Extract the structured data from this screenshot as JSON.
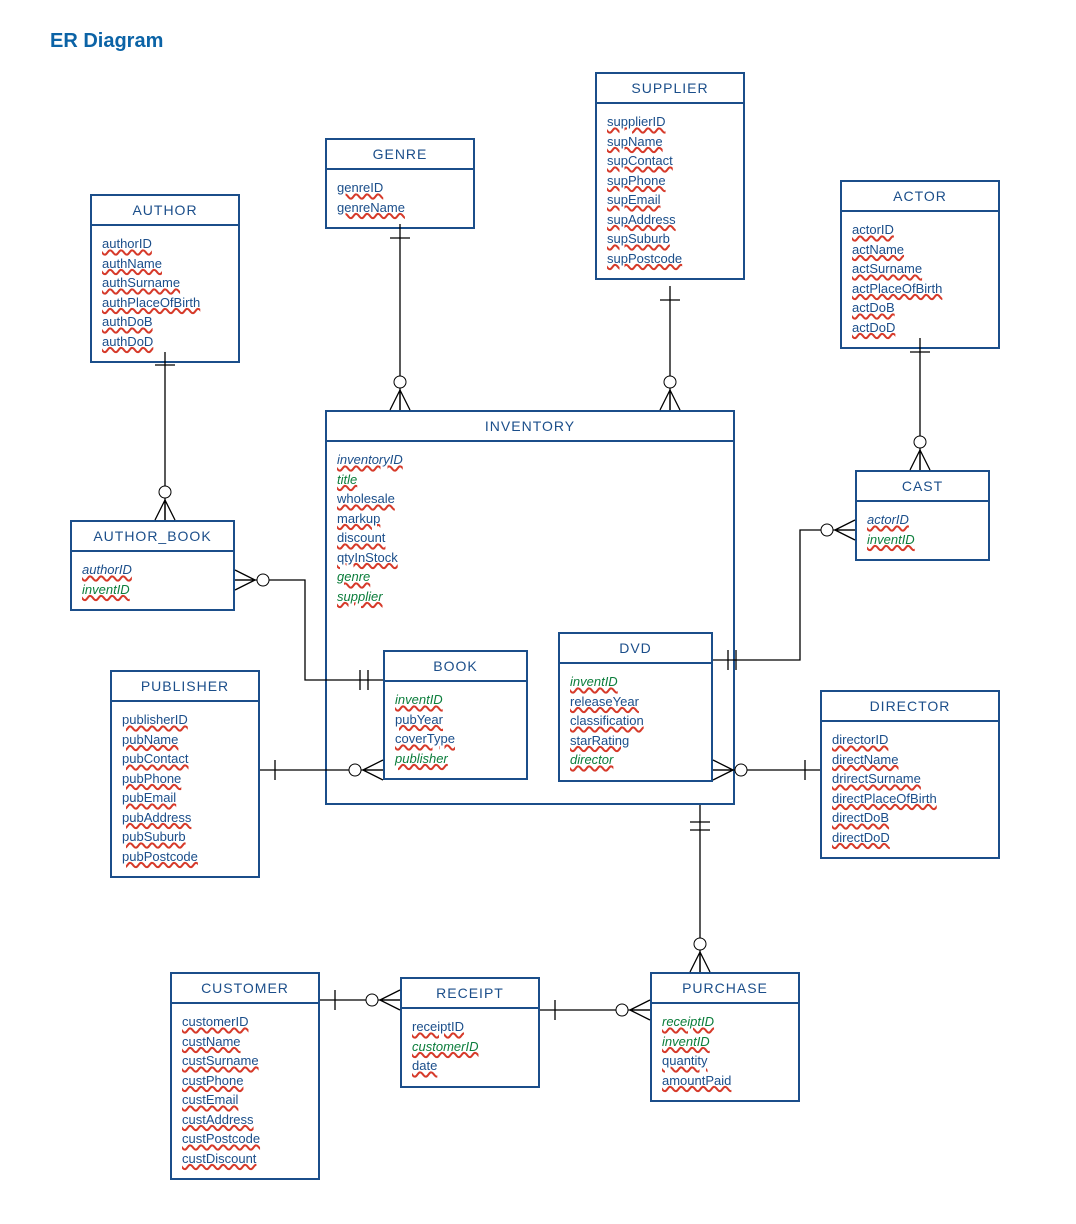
{
  "title": "ER Diagram",
  "entities": {
    "author": {
      "name": "AUTHOR",
      "attrs": [
        "authorID",
        "authName",
        "authSurname",
        "authPlaceOfBirth",
        "authDoB",
        "authDoD"
      ]
    },
    "genre": {
      "name": "GENRE",
      "attrs": [
        "genreID",
        "genreName"
      ]
    },
    "supplier": {
      "name": "SUPPLIER",
      "attrs": [
        "supplierID",
        "supName",
        "supContact",
        "supPhone",
        "supEmail",
        "supAddress",
        "supSuburb",
        "supPostcode"
      ]
    },
    "actor": {
      "name": "ACTOR",
      "attrs": [
        "actorID",
        "actName",
        "actSurname",
        "actPlaceOfBirth",
        "actDoB",
        "actDoD"
      ]
    },
    "author_book": {
      "name": "AUTHOR_BOOK",
      "attrs": [
        "authorID",
        "inventID"
      ]
    },
    "inventory": {
      "name": "INVENTORY",
      "attrs": [
        "inventoryID",
        "title",
        "wholesale",
        "markup",
        "discount",
        "qtyInStock",
        "genre",
        "supplier"
      ]
    },
    "cast": {
      "name": "CAST",
      "attrs": [
        "actorID",
        "inventID"
      ]
    },
    "publisher": {
      "name": "PUBLISHER",
      "attrs": [
        "publisherID",
        "pubName",
        "pubContact",
        "pubPhone",
        "pubEmail",
        "pubAddress",
        "pubSuburb",
        "pubPostcode"
      ]
    },
    "book": {
      "name": "BOOK",
      "attrs": [
        "inventID",
        "pubYear",
        "coverType",
        "publisher"
      ]
    },
    "dvd": {
      "name": "DVD",
      "attrs": [
        "inventID",
        "releaseYear",
        "classification",
        "starRating",
        "director"
      ]
    },
    "director": {
      "name": "DIRECTOR",
      "attrs": [
        "directorID",
        "directName",
        "drirectSurname",
        "directPlaceOfBirth",
        "directDoB",
        "directDoD"
      ]
    },
    "customer": {
      "name": "CUSTOMER",
      "attrs": [
        "customerID",
        "custName",
        "custSurname",
        "custPhone",
        "custEmail",
        "custAddress",
        "custPostcode",
        "custDiscount"
      ]
    },
    "receipt": {
      "name": "RECEIPT",
      "attrs": [
        "receiptID",
        "customerID",
        "date"
      ]
    },
    "purchase": {
      "name": "PURCHASE",
      "attrs": [
        "receiptID",
        "inventID",
        "quantity",
        "amountPaid"
      ]
    }
  },
  "chart_data": {
    "type": "er-diagram",
    "entities": [
      {
        "name": "AUTHOR",
        "attributes": [
          "authorID",
          "authName",
          "authSurname",
          "authPlaceOfBirth",
          "authDoB",
          "authDoD"
        ],
        "pk": [
          "authorID"
        ]
      },
      {
        "name": "GENRE",
        "attributes": [
          "genreID",
          "genreName"
        ],
        "pk": [
          "genreID"
        ]
      },
      {
        "name": "SUPPLIER",
        "attributes": [
          "supplierID",
          "supName",
          "supContact",
          "supPhone",
          "supEmail",
          "supAddress",
          "supSuburb",
          "supPostcode"
        ],
        "pk": [
          "supplierID"
        ]
      },
      {
        "name": "ACTOR",
        "attributes": [
          "actorID",
          "actName",
          "actSurname",
          "actPlaceOfBirth",
          "actDoB",
          "actDoD"
        ],
        "pk": [
          "actorID"
        ]
      },
      {
        "name": "AUTHOR_BOOK",
        "attributes": [
          "authorID",
          "inventID"
        ],
        "pk": [
          "authorID",
          "inventID"
        ],
        "fk": [
          "authorID",
          "inventID"
        ]
      },
      {
        "name": "INVENTORY",
        "attributes": [
          "inventoryID",
          "title",
          "wholesale",
          "markup",
          "discount",
          "qtyInStock",
          "genre",
          "supplier"
        ],
        "pk": [
          "inventoryID"
        ],
        "fk": [
          "genre",
          "supplier"
        ]
      },
      {
        "name": "CAST",
        "attributes": [
          "actorID",
          "inventID"
        ],
        "pk": [
          "actorID",
          "inventID"
        ],
        "fk": [
          "actorID",
          "inventID"
        ]
      },
      {
        "name": "PUBLISHER",
        "attributes": [
          "publisherID",
          "pubName",
          "pubContact",
          "pubPhone",
          "pubEmail",
          "pubAddress",
          "pubSuburb",
          "pubPostcode"
        ],
        "pk": [
          "publisherID"
        ]
      },
      {
        "name": "BOOK",
        "attributes": [
          "inventID",
          "pubYear",
          "coverType",
          "publisher"
        ],
        "pk": [
          "inventID"
        ],
        "fk": [
          "inventID",
          "publisher"
        ]
      },
      {
        "name": "DVD",
        "attributes": [
          "inventID",
          "releaseYear",
          "classification",
          "starRating",
          "director"
        ],
        "pk": [
          "inventID"
        ],
        "fk": [
          "inventID",
          "director"
        ]
      },
      {
        "name": "DIRECTOR",
        "attributes": [
          "directorID",
          "directName",
          "drirectSurname",
          "directPlaceOfBirth",
          "directDoB",
          "directDoD"
        ],
        "pk": [
          "directorID"
        ]
      },
      {
        "name": "CUSTOMER",
        "attributes": [
          "customerID",
          "custName",
          "custSurname",
          "custPhone",
          "custEmail",
          "custAddress",
          "custPostcode",
          "custDiscount"
        ],
        "pk": [
          "customerID"
        ]
      },
      {
        "name": "RECEIPT",
        "attributes": [
          "receiptID",
          "customerID",
          "date"
        ],
        "pk": [
          "receiptID"
        ],
        "fk": [
          "customerID"
        ]
      },
      {
        "name": "PURCHASE",
        "attributes": [
          "receiptID",
          "inventID",
          "quantity",
          "amountPaid"
        ],
        "pk": [
          "receiptID",
          "inventID"
        ],
        "fk": [
          "receiptID",
          "inventID"
        ]
      }
    ],
    "relationships": [
      {
        "from": "AUTHOR",
        "to": "AUTHOR_BOOK",
        "cardinality": "1..*"
      },
      {
        "from": "AUTHOR_BOOK",
        "to": "BOOK",
        "cardinality": "*..1"
      },
      {
        "from": "GENRE",
        "to": "INVENTORY",
        "cardinality": "1..*"
      },
      {
        "from": "SUPPLIER",
        "to": "INVENTORY",
        "cardinality": "1..*"
      },
      {
        "from": "ACTOR",
        "to": "CAST",
        "cardinality": "1..*"
      },
      {
        "from": "CAST",
        "to": "DVD",
        "cardinality": "*..1"
      },
      {
        "from": "INVENTORY",
        "to": "BOOK",
        "cardinality": "1..1"
      },
      {
        "from": "INVENTORY",
        "to": "DVD",
        "cardinality": "1..1"
      },
      {
        "from": "PUBLISHER",
        "to": "BOOK",
        "cardinality": "1..*"
      },
      {
        "from": "DIRECTOR",
        "to": "DVD",
        "cardinality": "1..*"
      },
      {
        "from": "DVD",
        "to": "PURCHASE",
        "cardinality": "1..*"
      },
      {
        "from": "CUSTOMER",
        "to": "RECEIPT",
        "cardinality": "1..*"
      },
      {
        "from": "RECEIPT",
        "to": "PURCHASE",
        "cardinality": "1..*"
      }
    ]
  }
}
